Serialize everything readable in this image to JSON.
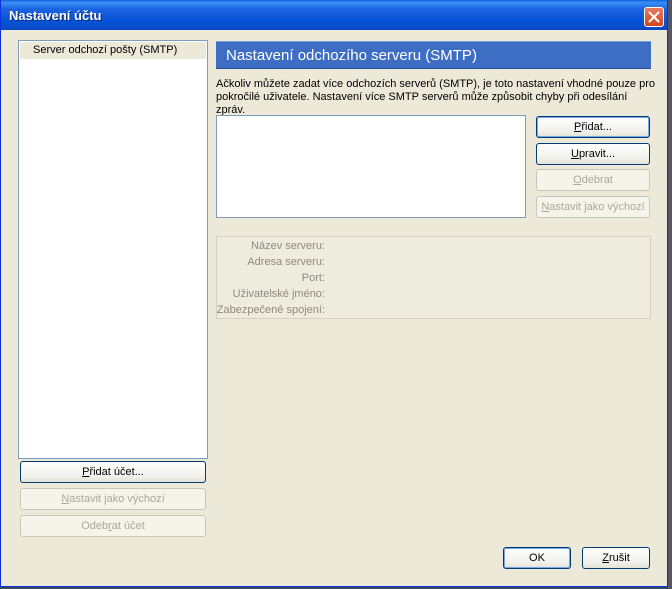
{
  "window": {
    "title": "Nastavení účtu"
  },
  "sidebar": {
    "items": [
      {
        "label": "Server odchozí pošty (SMTP)"
      }
    ],
    "add_account": {
      "pre": "",
      "key": "P",
      "post": "řidat účet..."
    },
    "set_default": {
      "pre": "",
      "key": "N",
      "post": "astavit jako výchozí"
    },
    "remove_account": {
      "pre": "Odeb",
      "key": "r",
      "post": "at účet"
    }
  },
  "main": {
    "title": "Nastavení odchozího serveru (SMTP)",
    "description_line1": "Ačkoliv můžete zadat více odchozích serverů (SMTP), je toto nastavení vhodné pouze pro",
    "description_line2": "pokročilé uživatele. Nastavení více SMTP serverů může způsobit chyby při odesílání zpráv.",
    "buttons": {
      "add": {
        "pre": "",
        "key": "P",
        "post": "řidat..."
      },
      "edit": {
        "pre": "",
        "key": "U",
        "post": "pravit..."
      },
      "remove": {
        "pre": "",
        "key": "O",
        "post": "debrat"
      },
      "set_default": {
        "pre": "",
        "key": "N",
        "post": "astavit jako výchozí"
      }
    },
    "details": {
      "server_name": "Název serveru:",
      "server_address": "Adresa serveru:",
      "port": "Port:",
      "username": "Uživatelské jméno:",
      "secure_connection": "Zabezpečené spojení:"
    }
  },
  "footer": {
    "ok": "OK",
    "cancel": {
      "pre": "",
      "key": "Z",
      "post": "rušit"
    }
  },
  "colors": {
    "titlebar": "#0653d6",
    "header": "#3d6ec4",
    "dialog_bg": "#ece9d8"
  },
  "icons": {
    "close": "close-icon"
  }
}
